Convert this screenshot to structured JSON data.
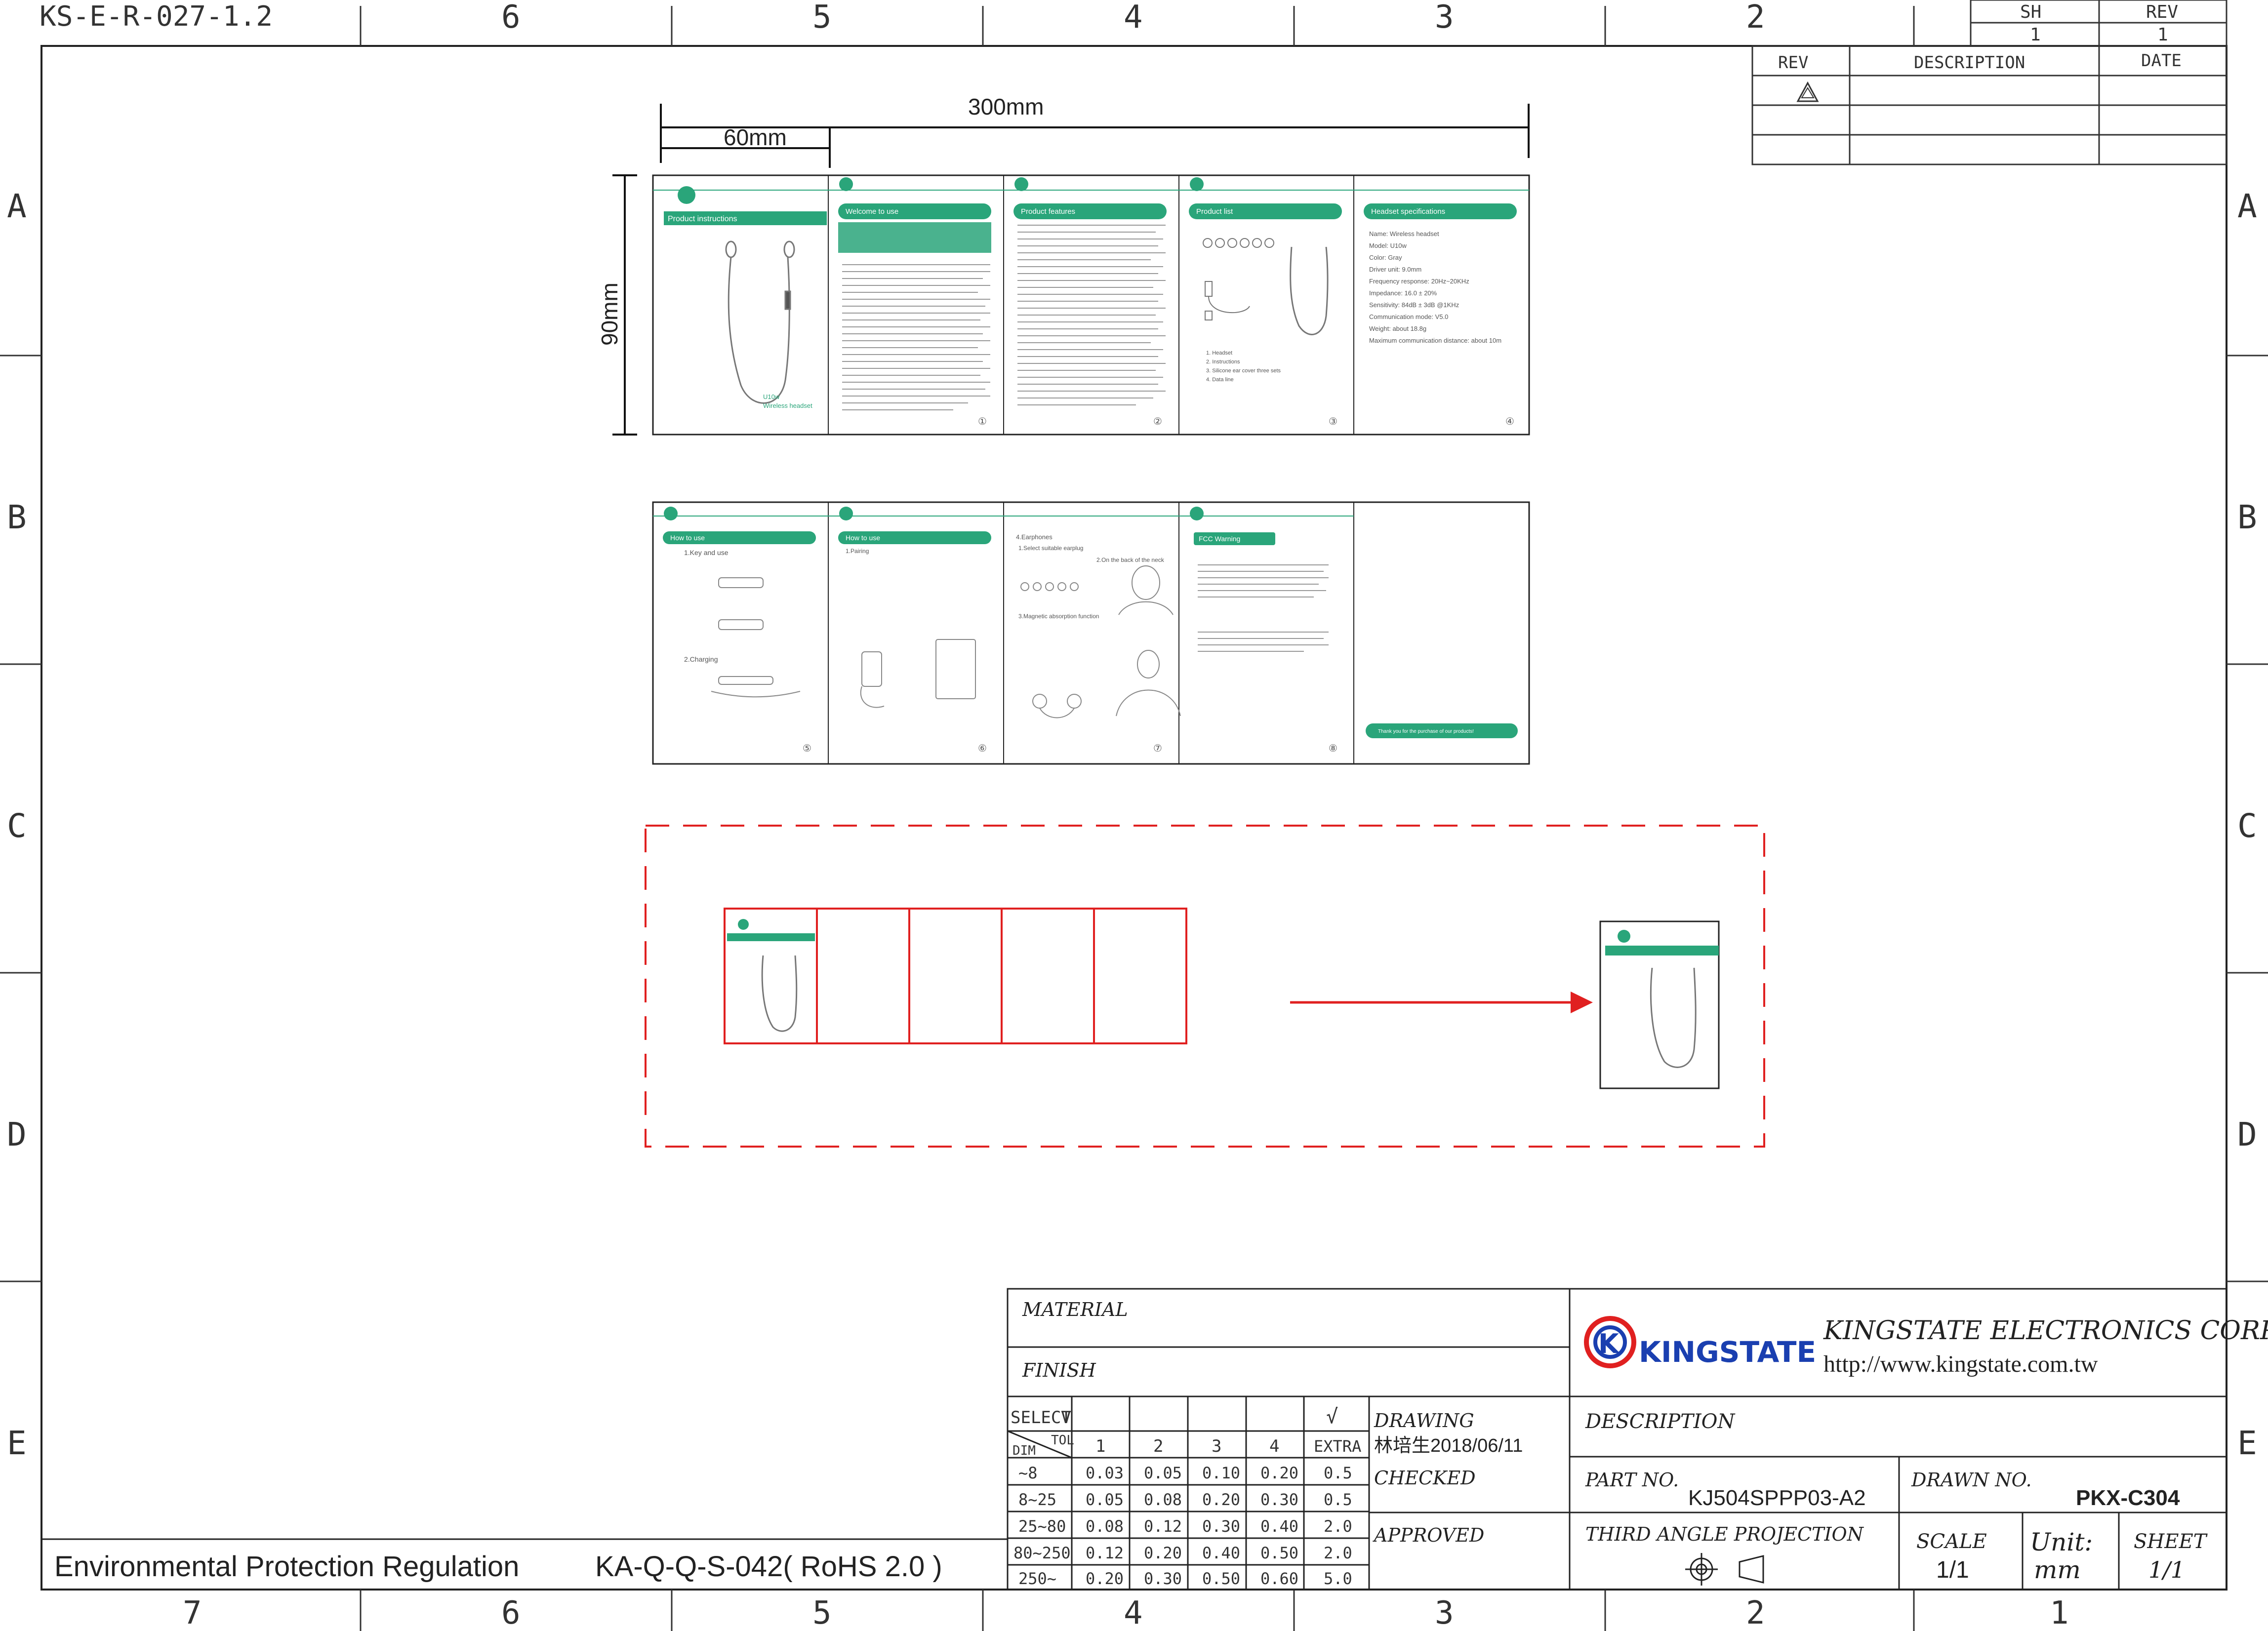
{
  "drawing_code": "KS-E-R-027-1.2",
  "column_labels": [
    "7",
    "6",
    "5",
    "4",
    "3",
    "2",
    "1"
  ],
  "top_column_labels": [
    "6",
    "5",
    "4",
    "3",
    "2"
  ],
  "row_labels": [
    "A",
    "B",
    "C",
    "D",
    "E"
  ],
  "sheet_block": {
    "sh_label": "SH",
    "rev_label": "REV",
    "sh_value": "1",
    "rev_value": "1"
  },
  "revision_table": {
    "rev": "REV",
    "description": "DESCRIPTION",
    "date": "DATE"
  },
  "dimensions": {
    "total_width": "300mm",
    "panel_width": "60mm",
    "height": "90mm"
  },
  "brand_text": {
    "product_instructions": "Product instructions",
    "model": "U10w",
    "wireless_headset": "Wireless headset",
    "welcome": "Welcome to use",
    "features": "Product features",
    "product_list": "Product list",
    "specifications": "Headset specifications",
    "how_to_use": "How to use",
    "fcc": "FCC Warning",
    "thanks": "Thank you for the purchase of our products!"
  },
  "specs": [
    "Name: Wireless headset",
    "Model: U10w",
    "Color: Gray",
    "Driver unit: 9.0mm",
    "Frequency response: 20Hz~20KHz",
    "Impedance: 16.0 ± 20%",
    "Sensitivity: 84dB ± 3dB @1KHz",
    "Communication mode: V5.0",
    "Weight: about 18.8g",
    "Maximum communication distance: about 10m"
  ],
  "product_list": [
    "1. Headset",
    "2. Instructions",
    "3. Silicone ear cover three sets",
    "4. Data line"
  ],
  "page_numbers": [
    "①",
    "②",
    "③",
    "④",
    "⑤",
    "⑥",
    "⑦",
    "⑧"
  ],
  "howto": {
    "key_and_use": "1.Key and use",
    "charging": "2.Charging",
    "pairing": "1.Pairing",
    "earphones": "4.Earphones",
    "suitable": "1.Select suitable earplug",
    "back_of_neck": "2.On the back of the neck",
    "magnetic": "3.Magnetic absorption function"
  },
  "material_label": "MATERIAL",
  "finish_label": "FINISH",
  "tolerance_table": {
    "select_label": "SELECT",
    "check": "√",
    "dim_label": "DIM",
    "tol_label": "TOL",
    "columns": [
      "1",
      "2",
      "3",
      "4",
      "EXTRA"
    ],
    "rows": [
      {
        "dim": "~8",
        "values": [
          "0.03",
          "0.05",
          "0.10",
          "0.20",
          "0.5"
        ]
      },
      {
        "dim": "8~25",
        "values": [
          "0.05",
          "0.08",
          "0.20",
          "0.30",
          "0.5"
        ]
      },
      {
        "dim": "25~80",
        "values": [
          "0.08",
          "0.12",
          "0.30",
          "0.40",
          "2.0"
        ]
      },
      {
        "dim": "80~250",
        "values": [
          "0.12",
          "0.20",
          "0.40",
          "0.50",
          "2.0"
        ]
      },
      {
        "dim": "250~",
        "values": [
          "0.20",
          "0.30",
          "0.50",
          "0.60",
          "5.0"
        ]
      }
    ]
  },
  "drawing_label": "DRAWING",
  "drawn_by": "林培生2018/06/11",
  "checked_label": "CHECKED",
  "approved_label": "APPROVED",
  "company": {
    "logo_text": "KINGSTATE",
    "name": "KINGSTATE ELECTRONICS CORP.",
    "url": "http://www.kingstate.com.tw"
  },
  "description_label": "DESCRIPTION",
  "part_no_label": "PART NO.",
  "part_no": "KJ504SPPP03-A2",
  "drawn_no_label": "DRAWN NO.",
  "drawn_no": "PKX-C304",
  "projection_label": "THIRD ANGLE PROJECTION",
  "scale_label": "SCALE",
  "scale_value": "1/1",
  "unit_label": "Unit:",
  "unit_value": "mm",
  "sheet_label": "SHEET",
  "sheet_value": "1/1",
  "regulation": {
    "label": "Environmental  Protection  Regulation",
    "code": "KA-Q-Q-S-042( RoHS 2.0 )"
  }
}
